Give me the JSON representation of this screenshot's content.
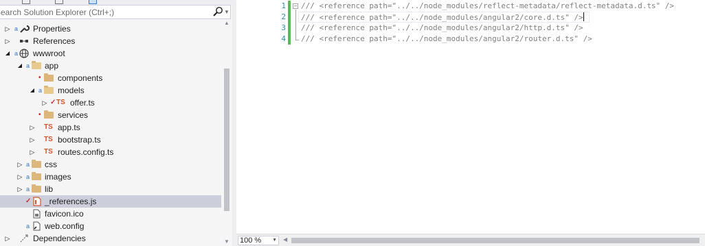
{
  "solution_explorer": {
    "search_placeholder": "Search Solution Explorer (Ctrl+;)",
    "tree": [
      {
        "label": "Properties",
        "icon": "wrench-icon",
        "state": "collapsed"
      },
      {
        "label": "References",
        "icon": "references-icon",
        "state": "collapsed"
      },
      {
        "label": "wwwroot",
        "icon": "globe-icon",
        "state": "expanded"
      },
      {
        "label": "app",
        "icon": "folder-icon",
        "state": "expanded"
      },
      {
        "label": "components",
        "icon": "folder-icon",
        "state": "none"
      },
      {
        "label": "models",
        "icon": "folder-icon",
        "state": "expanded"
      },
      {
        "label": "offer.ts",
        "icon": "typescript-icon",
        "state": "collapsed"
      },
      {
        "label": "services",
        "icon": "folder-icon",
        "state": "none"
      },
      {
        "label": "app.ts",
        "icon": "typescript-icon",
        "state": "collapsed"
      },
      {
        "label": "bootstrap.ts",
        "icon": "typescript-icon",
        "state": "collapsed"
      },
      {
        "label": "routes.config.ts",
        "icon": "typescript-icon",
        "state": "collapsed"
      },
      {
        "label": "css",
        "icon": "folder-icon",
        "state": "collapsed"
      },
      {
        "label": "images",
        "icon": "folder-icon",
        "state": "collapsed"
      },
      {
        "label": "lib",
        "icon": "folder-icon",
        "state": "collapsed"
      },
      {
        "label": "_references.js",
        "icon": "js-file-icon",
        "state": "selected"
      },
      {
        "label": "favicon.ico",
        "icon": "image-file-icon",
        "state": "none"
      },
      {
        "label": "web.config",
        "icon": "config-file-icon",
        "state": "none"
      },
      {
        "label": "Dependencies",
        "icon": "dependencies-icon",
        "state": "collapsed"
      }
    ],
    "ts_badge": "TS"
  },
  "editor": {
    "line_numbers": [
      "1",
      "2",
      "3",
      "4"
    ],
    "lines": [
      "/// <reference path=\"../../node_modules/reflect-metadata/reflect-metadata.d.ts\" />",
      "/// <reference path=\"../../node_modules/angular2/core.d.ts\" />",
      "/// <reference path=\"../../node_modules/angular2/http.d.ts\" />",
      "/// <reference path=\"../../node_modules/angular2/router.d.ts\" />"
    ],
    "zoom": "100 %"
  },
  "colors": {
    "line_number": "#2b91af",
    "comment": "#808080",
    "change_bar": "#5cb85c",
    "selection": "#cccedb",
    "folder": "#dcb67a",
    "typescript": "#d4542a"
  }
}
